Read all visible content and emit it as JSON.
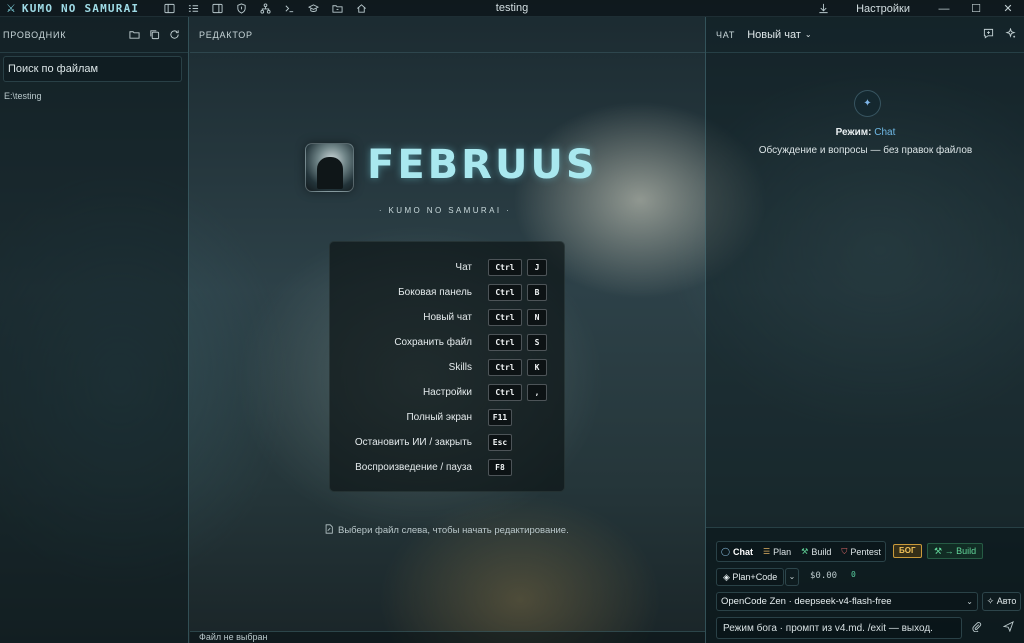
{
  "titlebar": {
    "brand": "KUMO NO SAMURAI",
    "window_title": "testing",
    "settings_label": "Настройки",
    "icons": [
      "sidebar-icon",
      "list-icon",
      "panel-icon",
      "shield-icon",
      "tree-icon",
      "terminal-icon",
      "graduation-icon",
      "folder-icon",
      "home-icon"
    ]
  },
  "explorer": {
    "title": "ПРОВОДНИК",
    "search_placeholder": "Поиск по файлам",
    "path": "E:\\testing"
  },
  "editor": {
    "title": "РЕДАКТОР",
    "status": "Файл не выбран",
    "app_name": "FEBRUUS",
    "tagline": "· KUMO NO SAMURAI ·",
    "hint": "Выбери файл слева, чтобы начать редактирование.",
    "shortcuts": [
      {
        "label": "Чат",
        "k1": "Ctrl",
        "k2": "J"
      },
      {
        "label": "Боковая панель",
        "k1": "Ctrl",
        "k2": "B"
      },
      {
        "label": "Новый чат",
        "k1": "Ctrl",
        "k2": "N"
      },
      {
        "label": "Сохранить файл",
        "k1": "Ctrl",
        "k2": "S"
      },
      {
        "label": "Skills",
        "k1": "Ctrl",
        "k2": "K"
      },
      {
        "label": "Настройки",
        "k1": "Ctrl",
        "k2": ","
      },
      {
        "label": "Полный экран",
        "k1": "F11",
        "k2": ""
      },
      {
        "label": "Остановить ИИ / закрыть",
        "k1": "Esc",
        "k2": ""
      },
      {
        "label": "Воспроизведение / пауза",
        "k1": "F8",
        "k2": ""
      }
    ]
  },
  "chat": {
    "title": "ЧАТ",
    "new_chat": "Новый чат",
    "mode_prefix": "Режим:",
    "mode_value": "Chat",
    "mode_desc": "Обсуждение и вопросы — без правок файлов",
    "tabs": [
      "Chat",
      "Plan",
      "Build",
      "Pentest"
    ],
    "bog_badge": "БОГ",
    "to_build": "→ Build",
    "plan_code": "Plan+Code",
    "cost": "$0.00",
    "counter": "0",
    "model": "OpenCode Zen · deepseek-v4-flash-free",
    "auto": "Авто",
    "prompt_placeholder": "Режим бога · промпт из v4.md. /exit — выход."
  },
  "colors": {
    "accent": "#a9e8ef",
    "mode_link": "#6fb9e6",
    "bog": "#f4c45a",
    "build_green": "#62d69a"
  }
}
